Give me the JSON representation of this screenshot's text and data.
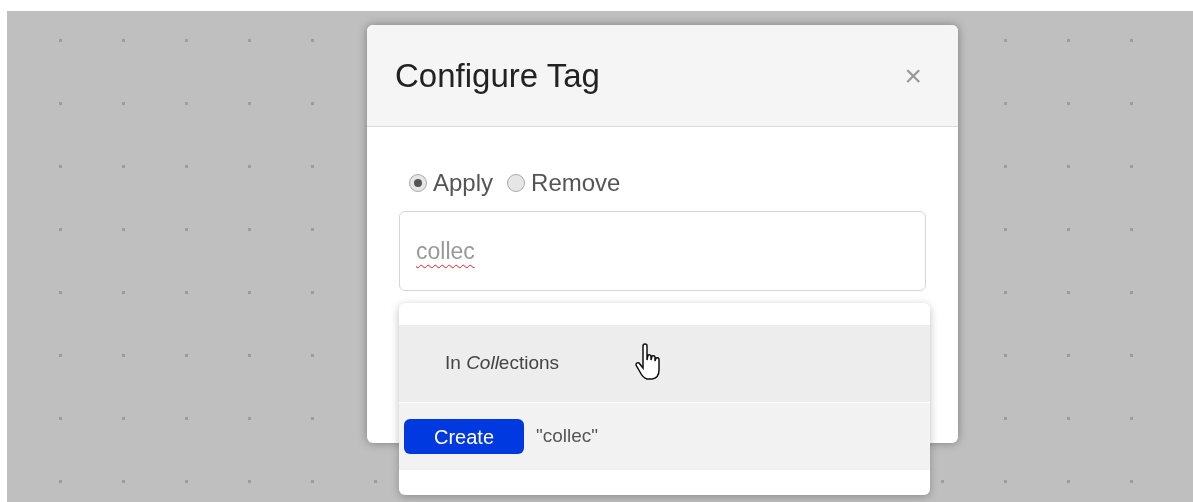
{
  "dialog": {
    "title": "Configure Tag",
    "close": "×",
    "options": [
      {
        "label": "Apply",
        "selected": true
      },
      {
        "label": "Remove",
        "selected": false
      }
    ],
    "input": {
      "value": "collec",
      "misspelled": true
    }
  },
  "suggestions": [
    {
      "kind": "match",
      "parts": [
        {
          "text": "In ",
          "italic": false
        },
        {
          "text": "Coll",
          "italic": true
        },
        {
          "text": "ections",
          "italic": false
        }
      ]
    },
    {
      "kind": "create",
      "button": "Create",
      "text": "\"collec\""
    }
  ]
}
